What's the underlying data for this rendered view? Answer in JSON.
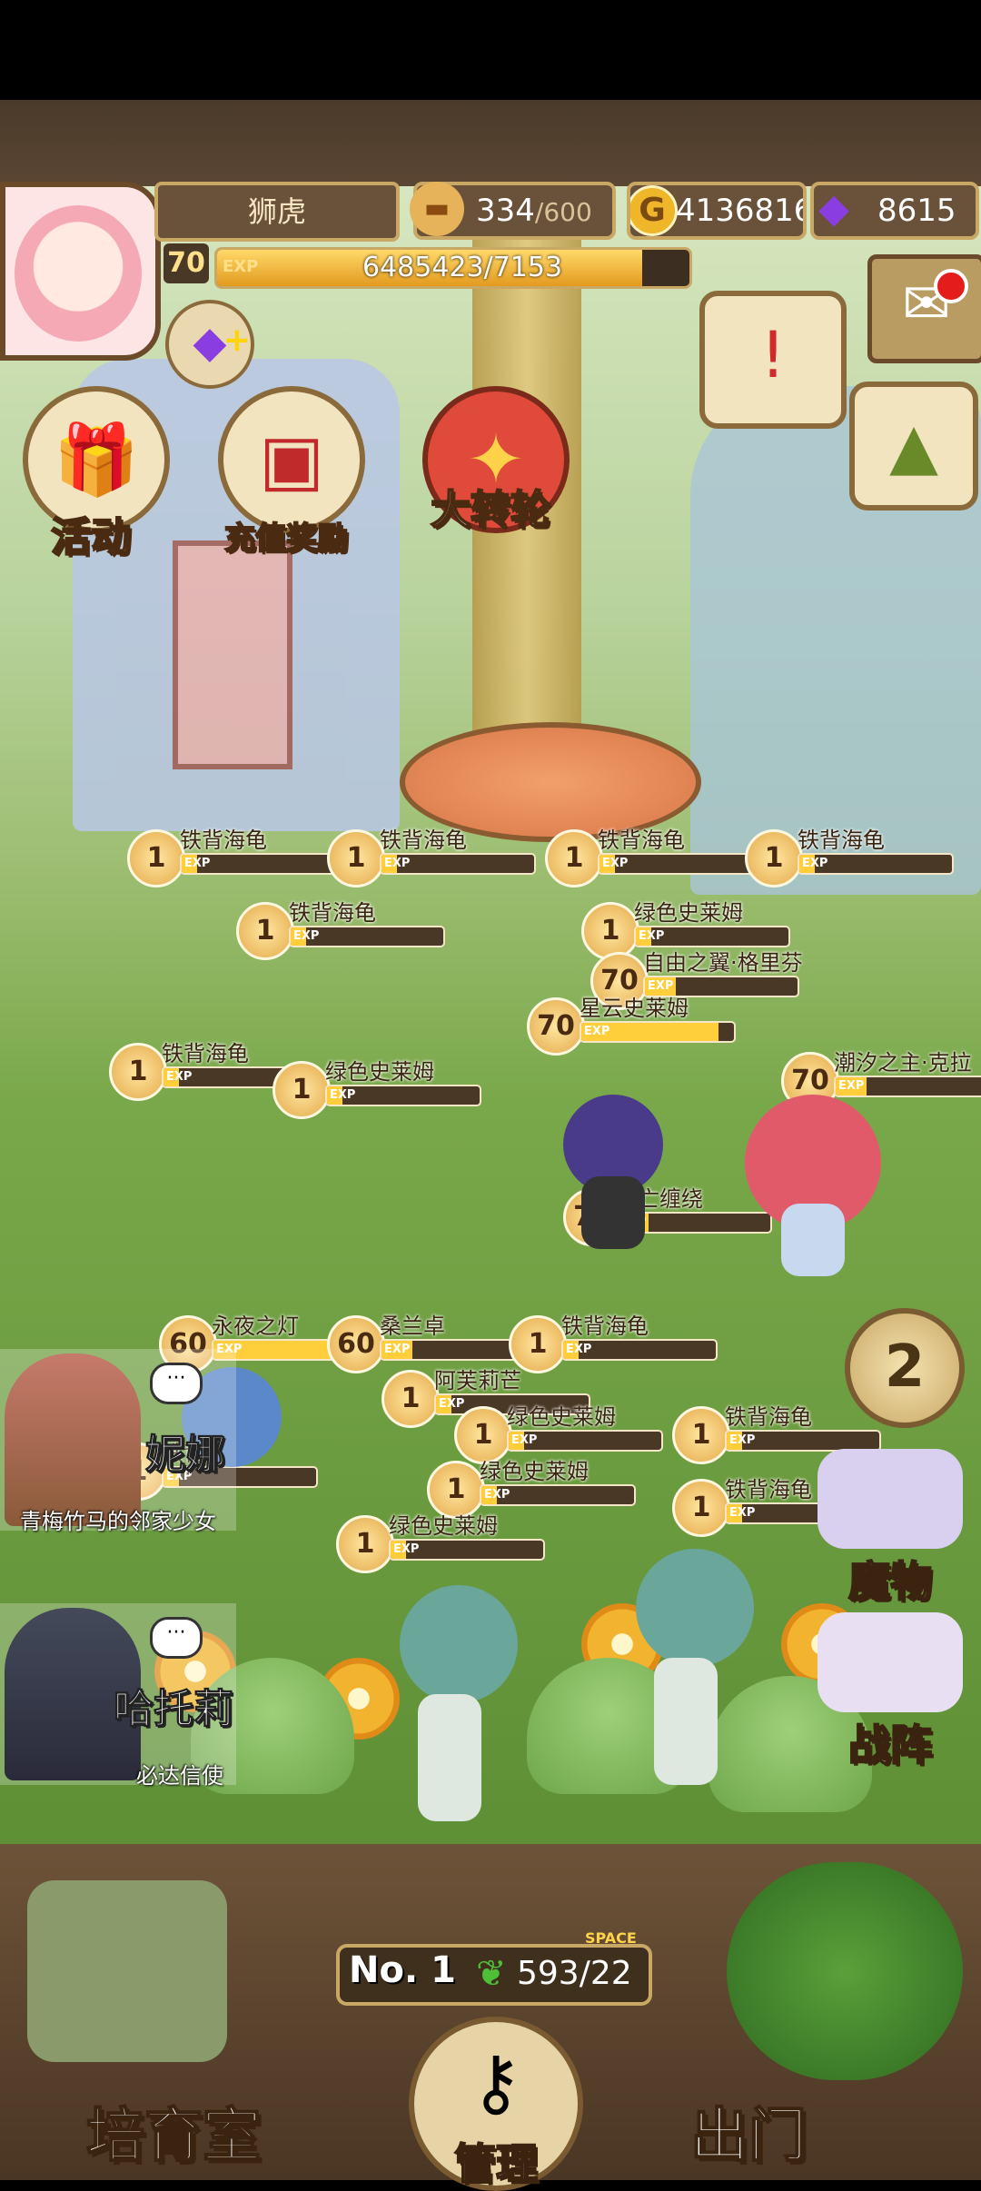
{
  "player": {
    "name": "狮虎",
    "level": "70",
    "exp_label": "EXP",
    "exp_text": "6485423/7153",
    "exp_progress": 0.9
  },
  "resources": {
    "stamina_value": "334",
    "stamina_max": "/600",
    "gold_icon": "G",
    "gold_value": "4136816",
    "gems_value": "8615"
  },
  "menu": {
    "activity": "活动",
    "recharge": "充值奖励",
    "wheel": "大转轮"
  },
  "monsters": [
    {
      "name": "铁背海龟",
      "level": "1",
      "exp": "EXP",
      "fill": 0.1
    },
    {
      "name": "铁背海龟",
      "level": "1",
      "exp": "EXP",
      "fill": 0.1
    },
    {
      "name": "铁背海龟",
      "level": "1",
      "exp": "EXP",
      "fill": 0.1
    },
    {
      "name": "铁背海龟",
      "level": "1",
      "exp": "EXP",
      "fill": 0.1
    },
    {
      "name": "铁背海龟",
      "level": "1",
      "exp": "EXP",
      "fill": 0.1
    },
    {
      "name": "绿色史莱姆",
      "level": "1",
      "exp": "EXP",
      "fill": 0.1
    },
    {
      "name": "自由之翼·格里芬",
      "level": "70",
      "exp": "EXP",
      "fill": 0.2
    },
    {
      "name": "星云史莱姆",
      "level": "70",
      "exp": "EXP",
      "fill": 0.9
    },
    {
      "name": "潮汐之主·克拉",
      "level": "70",
      "exp": "EXP",
      "fill": 0.2
    },
    {
      "name": "铁背海龟",
      "level": "1",
      "exp": "EXP",
      "fill": 0.1
    },
    {
      "name": "绿色史莱姆",
      "level": "1",
      "exp": "EXP",
      "fill": 0.1
    },
    {
      "name": "死亡缠绕",
      "level": "70",
      "exp": "EXP",
      "fill": 0.2
    },
    {
      "name": "永夜之灯",
      "level": "60",
      "exp": "EXP",
      "fill": 0.9
    },
    {
      "name": "桑兰卓",
      "level": "60",
      "exp": "EXP",
      "fill": 0.2
    },
    {
      "name": "阿芙莉芒",
      "level": "1",
      "exp": "EXP",
      "fill": 0.1
    },
    {
      "name": "铁背海龟",
      "level": "1",
      "exp": "EXP",
      "fill": 0.1
    },
    {
      "name": "绿色史莱姆",
      "level": "1",
      "exp": "EXP",
      "fill": 0.1
    },
    {
      "name": "铁背海龟",
      "level": "1",
      "exp": "EXP",
      "fill": 0.1
    },
    {
      "name": "绿色史莱姆",
      "level": "1",
      "exp": "EXP",
      "fill": 0.1
    },
    {
      "name": "铁背海龟",
      "level": "1",
      "exp": "EXP",
      "fill": 0.1
    },
    {
      "name": "绿色史莱姆",
      "level": "1",
      "exp": "EXP",
      "fill": 0.1
    },
    {
      "name": "铁背海龟",
      "level": "1",
      "exp": "EXP",
      "fill": 0.1
    }
  ],
  "npcs": {
    "nina_name": "妮娜",
    "nina_title": "青梅竹马的邻家少女",
    "hetuoli_name": "哈托莉",
    "hetuoli_title": "必达信使",
    "chat_dots": "···"
  },
  "right_nav": {
    "monsters": "魔物",
    "formation": "战阵",
    "page": "2"
  },
  "bottom": {
    "rank": "No. 1",
    "space_label": "SPACE",
    "space_value": "593/22",
    "nursery": "培育室",
    "manage": "管理",
    "exit": "出门"
  },
  "icons": {
    "bread": "bread-icon",
    "coin": "gold-coin-icon",
    "gem": "purple-gem-icon",
    "gift": "gift-icon",
    "chest": "treasure-chest-icon",
    "wheel": "wheel-icon",
    "scroll": "quest-scroll-icon",
    "mail": "mail-icon",
    "bag": "backpack-icon",
    "keys": "keys-icon",
    "leaf": "leaf-icon"
  },
  "colors": {
    "accent_gold": "#c9a865",
    "frame_brown": "#6a523a",
    "exp_fill": "#ffce3a",
    "alert_red": "#e51c1c"
  }
}
